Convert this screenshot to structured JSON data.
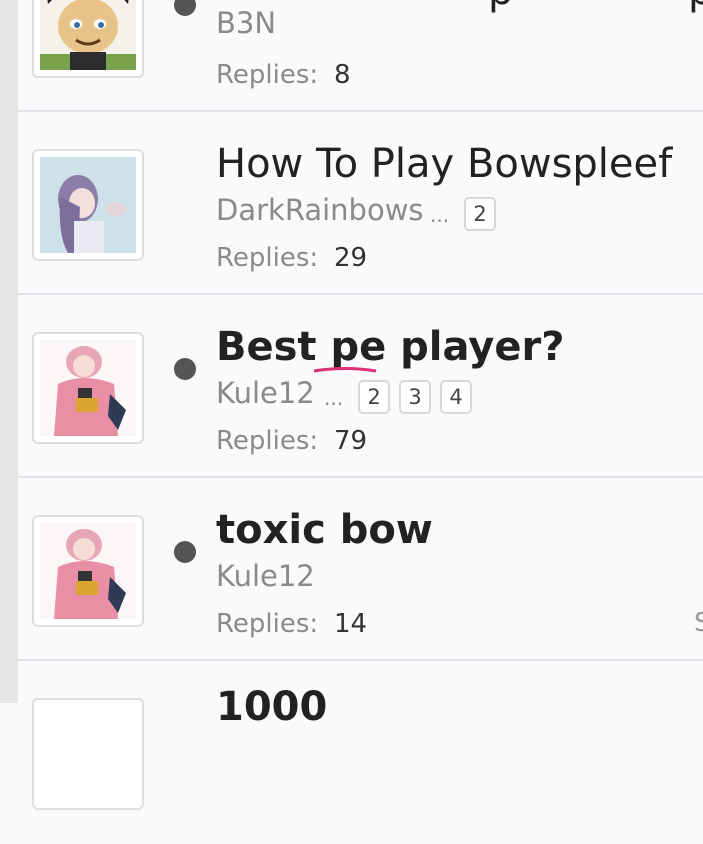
{
  "threads": [
    {
      "title": "“",
      "title_suffix": "p",
      "author": "B3N",
      "replies_label": "Replies:",
      "replies": "8",
      "unread": true,
      "avatar_icon": "cartoon-boy-avatar"
    },
    {
      "title": "How To Play Bowspleef",
      "author": "DarkRainbows",
      "ellipsis": "...",
      "pages": [
        "2"
      ],
      "replies_label": "Replies:",
      "replies": "29",
      "unread": false,
      "avatar_icon": "anime-girl-pastel-avatar"
    },
    {
      "title": "Best pe player?",
      "author": "Kule12",
      "ellipsis": "...",
      "pages": [
        "2",
        "3",
        "4"
      ],
      "replies_label": "Replies:",
      "replies": "79",
      "unread": true,
      "avatar_icon": "anime-pink-jacket-avatar"
    },
    {
      "title": "toxic bow",
      "author": "Kule12",
      "replies_label": "Replies:",
      "replies": "14",
      "unread": true,
      "avatar_icon": "anime-pink-jacket-avatar"
    },
    {
      "title": "1000",
      "unread": false
    }
  ],
  "colors": {
    "background": "#fafafc",
    "gutter": "#e6e6e6",
    "spellcheck_underline": "#e0307a",
    "unread_dot": "#555555"
  }
}
